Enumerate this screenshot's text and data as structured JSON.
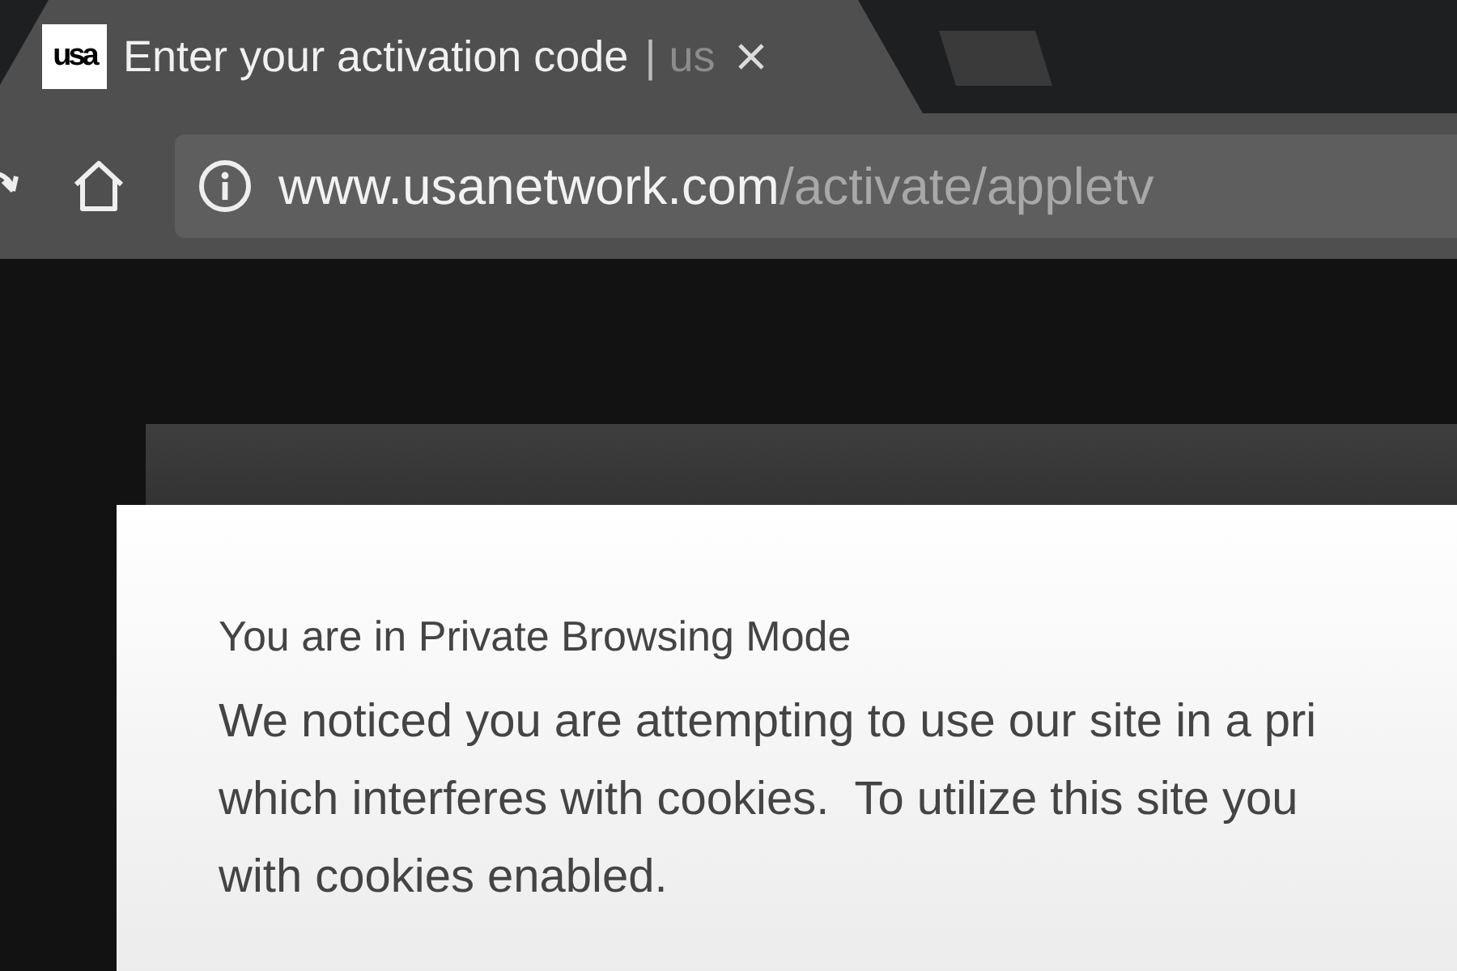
{
  "tab": {
    "favicon": "usa",
    "title": "Enter your activation code",
    "separator": "|",
    "title_suffix": "us",
    "selected": true
  },
  "address_bar": {
    "host": "www.usanetwork.com",
    "path": "/activate/appletv"
  },
  "dialog": {
    "heading": "You are in Private Browsing Mode",
    "message_lines": [
      "We noticed you are attempting to use our site in a pri",
      "which interferes with cookies.  To utilize this site you",
      "with cookies enabled."
    ]
  }
}
